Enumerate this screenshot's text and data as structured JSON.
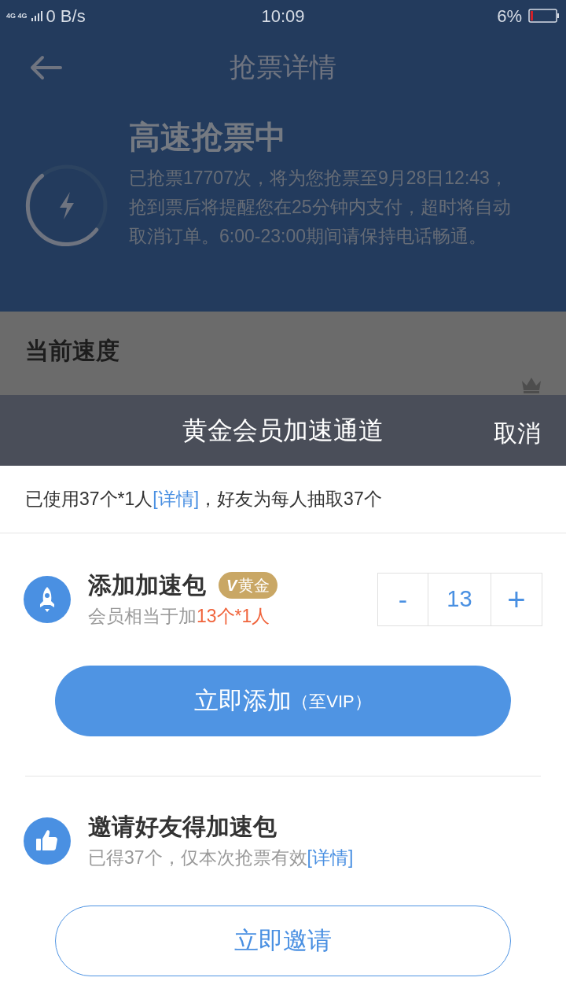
{
  "status_bar": {
    "network": "4G 4G",
    "speed": "0 B/s",
    "time": "10:09",
    "battery": "6%"
  },
  "header": {
    "title": "抢票详情"
  },
  "hero": {
    "title": "高速抢票中",
    "description": "已抢票17707次，将为您抢票至9月28日12:43，抢到票后将提醒您在25分钟内支付，超时将自动取消订单。6:00-23:00期间请保持电话畅通。"
  },
  "speed_section": {
    "title": "当前速度"
  },
  "sheet": {
    "title": "黄金会员加速通道",
    "cancel": "取消",
    "usage": {
      "before": "已使用37个*1人",
      "link": "[详情]",
      "after": "，好友为每人抽取37个"
    },
    "items": [
      {
        "kind": "stepper",
        "title": "添加加速包",
        "badge": "黄金",
        "badge_mark": "V",
        "subtitle": "会员相当于加",
        "highlight": "13个*1人",
        "minus": "-",
        "value": "13",
        "plus": "+",
        "button": "立即添加",
        "button_note": "（至VIP）"
      },
      {
        "kind": "invite",
        "title": "邀请好友得加速包",
        "subtitle": "已得37个，仅本次抢票有效",
        "link": "[详情]",
        "button": "立即邀请"
      }
    ]
  }
}
